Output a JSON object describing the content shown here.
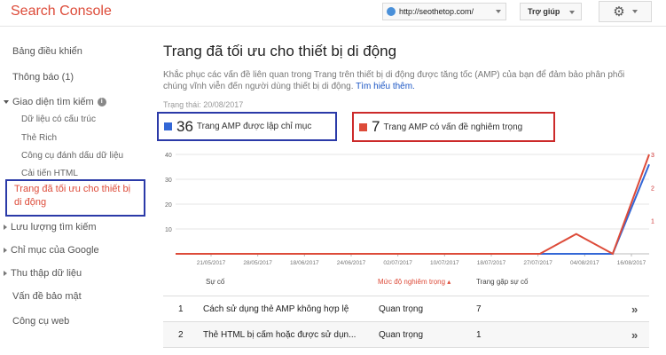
{
  "header": {
    "app_title": "Search Console",
    "site_url": "http://seothetop.com/",
    "help_label": "Trợ giúp"
  },
  "sidebar": {
    "items": [
      {
        "label": "Bảng điều khiển"
      },
      {
        "label": "Thông báo (1)"
      },
      {
        "label": "Giao diện tìm kiếm"
      },
      {
        "label": "Dữ liệu có cấu trúc"
      },
      {
        "label": "Thẻ Rich"
      },
      {
        "label": "Công cụ đánh dấu dữ liệu"
      },
      {
        "label": "Cải tiến HTML"
      },
      {
        "label": "Trang đã tối ưu cho thiết bị di động"
      },
      {
        "label": "Lưu lượng tìm kiếm"
      },
      {
        "label": "Chỉ mục của Google"
      },
      {
        "label": "Thu thập dữ liệu"
      },
      {
        "label": "Vấn đề bảo mật"
      },
      {
        "label": "Công cụ web"
      }
    ]
  },
  "main": {
    "title": "Trang đã tối ưu cho thiết bị di động",
    "description": "Khắc phục các vấn đề liên quan trong Trang trên thiết bị di động được tăng tốc (AMP) của bạn để đảm bảo phân phối chúng vĩnh viễn đến người dùng thiết bị di động.",
    "learn_more": "Tìm hiểu thêm.",
    "status_text": "Trạng thái: 20/08/2017",
    "card_indexed": {
      "count": "36",
      "label": "Trang AMP được lập chỉ mục",
      "color": "#3367d6"
    },
    "card_issues": {
      "count": "7",
      "label": "Trang AMP có vấn đề nghiêm trọng",
      "color": "#dd4b39"
    }
  },
  "chart_data": {
    "type": "line",
    "x": [
      "21/05/2017",
      "28/05/2017",
      "04/06/2017",
      "11/06/2017",
      "18/06/2017",
      "25/06/2017",
      "02/07/2017",
      "09/07/2017",
      "16/07/2017",
      "23/07/2017",
      "30/07/2017",
      "06/08/2017",
      "13/08/2017",
      "20/08/2017"
    ],
    "tick_labels": [
      "21/05/2017",
      "28/05/2017",
      "18/06/2017",
      "24/06/2017",
      "02/07/2017",
      "10/07/2017",
      "18/07/2017",
      "27/07/2017",
      "04/08/2017",
      "16/08/2017"
    ],
    "left_axis_ticks": [
      "40",
      "30",
      "20",
      "10"
    ],
    "right_axis_ticks": [
      "3",
      "2",
      "1"
    ],
    "ylim_left": [
      0,
      40
    ],
    "ylim_right": [
      0,
      3
    ],
    "series": [
      {
        "color": "#3367d6",
        "axis": "left",
        "values": [
          0,
          0,
          0,
          0,
          0,
          0,
          0,
          0,
          0,
          0,
          0,
          0,
          0,
          36
        ]
      },
      {
        "color": "#dd4b39",
        "axis": "right",
        "values": [
          0,
          0,
          0,
          0,
          0,
          0,
          0,
          0,
          0,
          0,
          0,
          0.6,
          0,
          3
        ]
      }
    ],
    "grid": true
  },
  "table": {
    "headers": {
      "issue": "Sự cố",
      "severity": "Mức độ nghiêm trọng ▴",
      "pages": "Trang gặp sự cố"
    },
    "rows": [
      {
        "index": "1",
        "issue": "Cách sử dụng thẻ AMP không hợp lệ",
        "severity": "Quan trọng",
        "pages": "7"
      },
      {
        "index": "2",
        "issue": "Thẻ HTML bị cấm hoặc được sử dụn...",
        "severity": "Quan trọng",
        "pages": "1"
      }
    ]
  }
}
